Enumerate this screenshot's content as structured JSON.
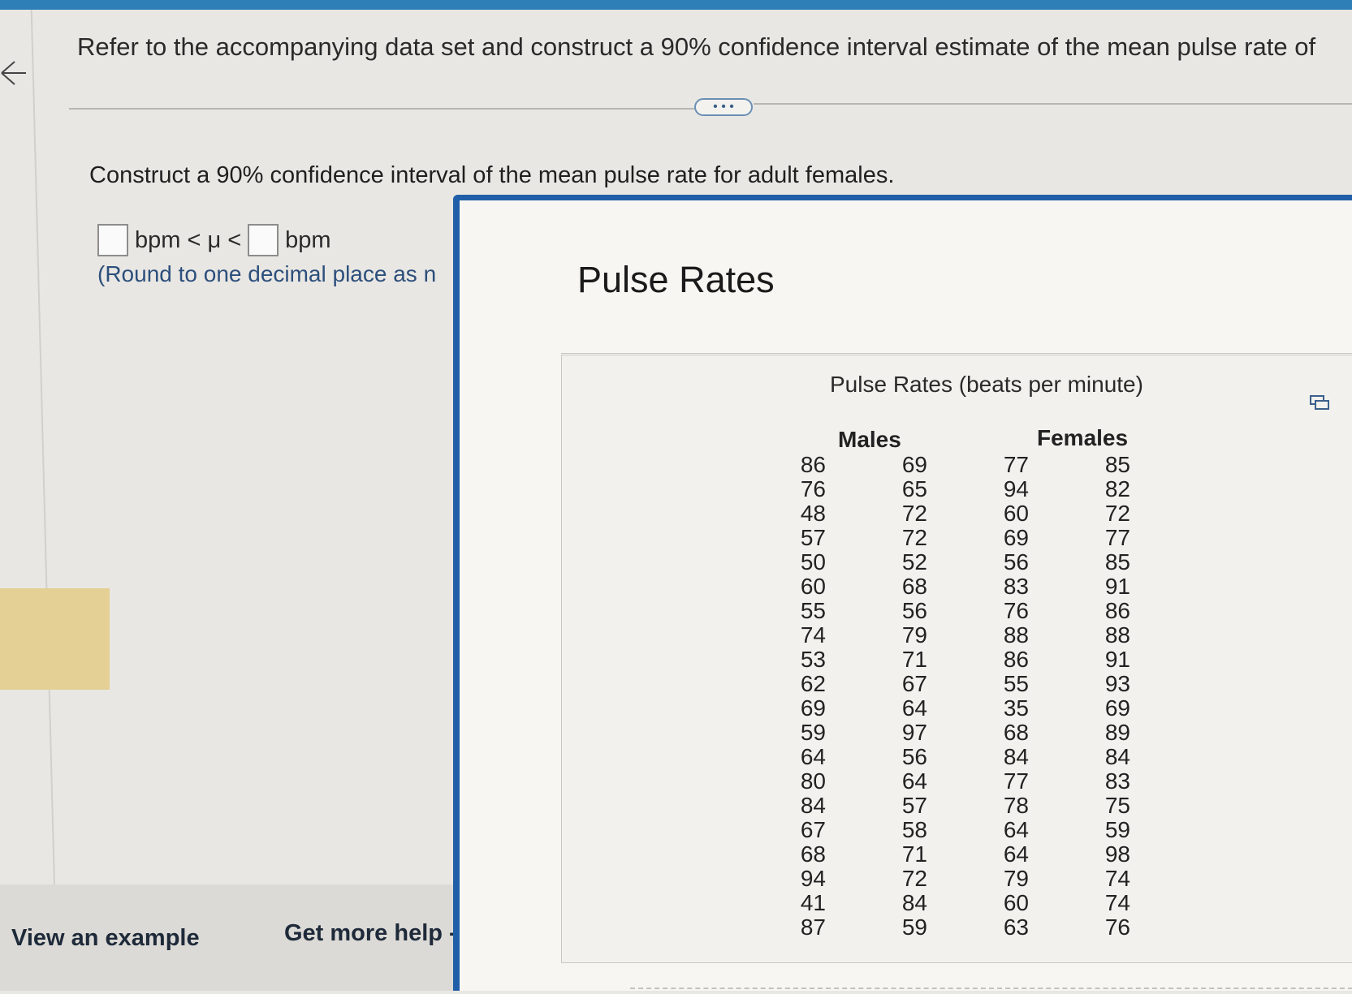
{
  "header": {
    "prompt_text": "Refer to the accompanying data set and construct a 90% confidence interval estimate of the mean pulse rate of",
    "more_label": "• • •"
  },
  "question": {
    "text": "Construct a 90% confidence interval of the mean pulse rate for adult females.",
    "unit_left": "bpm < μ <",
    "unit_right": "bpm",
    "round_note": "(Round to one decimal place as n"
  },
  "footer": {
    "view_example": "View an example",
    "get_more_help": "Get more help -"
  },
  "popup": {
    "title": "Pulse Rates",
    "table": {
      "title": "Pulse Rates (beats per minute)",
      "males_header": "Males",
      "females_header": "Females",
      "males_col1": [
        "86",
        "76",
        "48",
        "57",
        "50",
        "60",
        "55",
        "74",
        "53",
        "62",
        "69",
        "59",
        "64",
        "80",
        "84",
        "67",
        "68",
        "94",
        "41",
        "87"
      ],
      "males_col2": [
        "69",
        "65",
        "72",
        "72",
        "52",
        "68",
        "56",
        "79",
        "71",
        "67",
        "64",
        "97",
        "56",
        "64",
        "57",
        "58",
        "71",
        "72",
        "84",
        "59"
      ],
      "females_col1": [
        "77",
        "94",
        "60",
        "69",
        "56",
        "83",
        "76",
        "88",
        "86",
        "55",
        "35",
        "68",
        "84",
        "77",
        "78",
        "64",
        "64",
        "79",
        "60",
        "63"
      ],
      "females_col2": [
        "85",
        "82",
        "72",
        "77",
        "85",
        "91",
        "86",
        "88",
        "91",
        "93",
        "69",
        "89",
        "84",
        "83",
        "75",
        "59",
        "98",
        "74",
        "74",
        "76"
      ]
    }
  },
  "colors": {
    "accent_blue": "#205fa8",
    "topbar": "#2e7fb8",
    "highlight_yellow": "#e4cf94"
  },
  "icons": [
    "back-arrow-icon",
    "copy-icon"
  ]
}
